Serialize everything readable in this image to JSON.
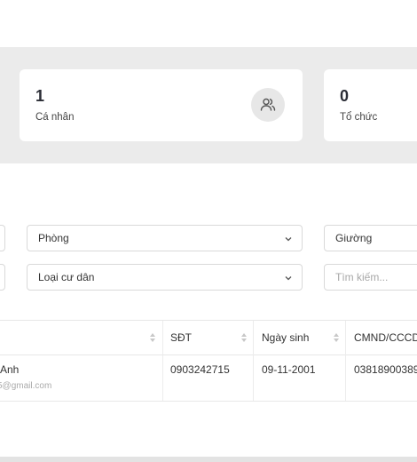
{
  "stats": [
    {
      "value": "1",
      "label": "Cá nhân",
      "icon": "users-icon"
    },
    {
      "value": "0",
      "label": "Tổ chức"
    }
  ],
  "filters": {
    "room": "Phòng",
    "bed": "Giường",
    "resident_type": "Loại cư dân",
    "search_placeholder": "Tìm kiếm..."
  },
  "table": {
    "columns": [
      "SĐT",
      "Ngày sinh",
      "CMND/CCCD"
    ],
    "rows": [
      {
        "name": "Anh",
        "email": "5@gmail.com",
        "phone": "0903242715",
        "dob": "09-11-2001",
        "id": "03818900389"
      }
    ]
  },
  "colors": {
    "band": "#ebebeb",
    "border": "#d9d9d9"
  }
}
